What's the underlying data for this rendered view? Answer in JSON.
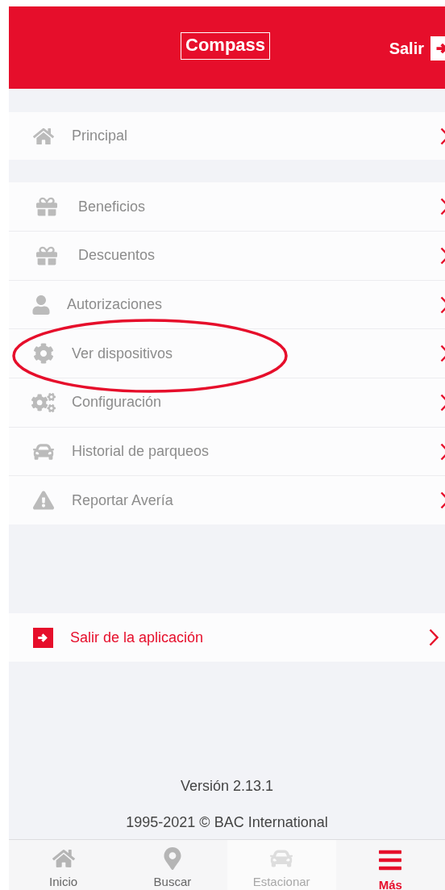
{
  "header": {
    "logo": "Compass",
    "logout": "Salir"
  },
  "main_menu": [
    {
      "label": "Principal"
    }
  ],
  "menu": [
    {
      "label": "Beneficios"
    },
    {
      "label": "Descuentos"
    },
    {
      "label": "Autorizaciones"
    },
    {
      "label": "Ver dispositivos"
    },
    {
      "label": "Configuración"
    },
    {
      "label": "Historial de parqueos"
    },
    {
      "label": "Reportar Avería"
    }
  ],
  "exit_item": {
    "label": "Salir de la aplicación"
  },
  "version": "Versión 2.13.1",
  "copyright": "1995-2021 © BAC International",
  "tabs": [
    {
      "label": "Inicio",
      "selected": false,
      "disabled": false
    },
    {
      "label": "Buscar",
      "selected": false,
      "disabled": false
    },
    {
      "label": "Estacionar",
      "selected": false,
      "disabled": true
    },
    {
      "label": "Más",
      "selected": true,
      "disabled": false
    }
  ]
}
